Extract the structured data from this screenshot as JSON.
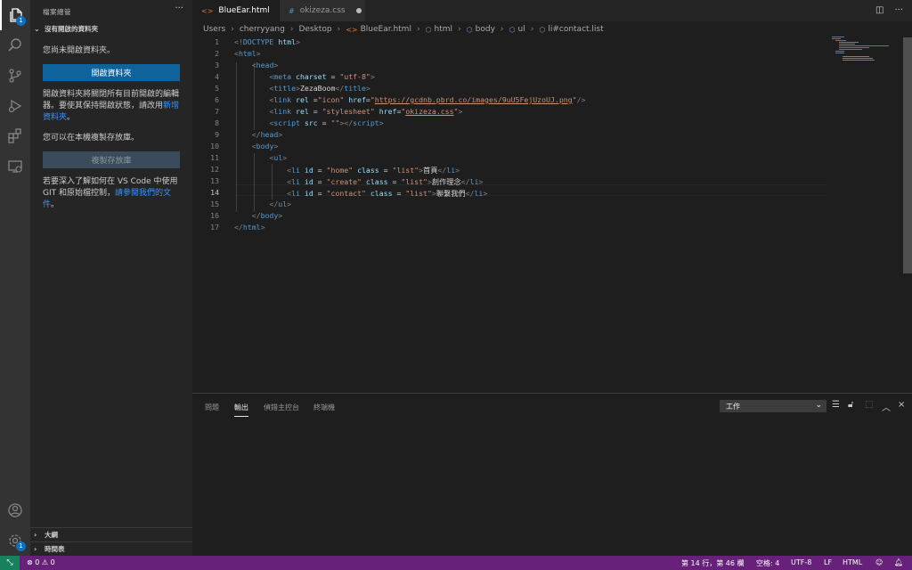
{
  "activity": {
    "explorer_badge": "1",
    "settings_badge": "1"
  },
  "sidebar": {
    "title": "檔案總管",
    "more": "···",
    "section_no_folder": "沒有開啟的資料夾",
    "msg_not_opened": "您尚未開啟資料夾。",
    "open_folder_btn": "開啟資料夾",
    "msg_close_1": "開啟資料夾將關閉所有目前開啟的編輯器。要使其保持開啟狀態，請改用",
    "msg_close_link": "新增資料夾",
    "msg_close_2": "。",
    "msg_clone": "您可以在本機複製存放庫。",
    "clone_btn": "複製存放庫",
    "msg_learn_1": "若要深入了解如何在 VS Code 中使用 GIT 和原始檔控制，",
    "msg_learn_link": "請參閱我們的文件",
    "msg_learn_2": "。",
    "section_outline": "大綱",
    "section_timeline": "時間表"
  },
  "tabs": [
    {
      "label": "BlueEar.html",
      "icon": "html-file-icon"
    },
    {
      "label": "okizeza.css",
      "icon": "css-file-icon"
    }
  ],
  "tab_icons": {
    "html": "<>",
    "css": "#"
  },
  "breadcrumb": [
    "Users",
    "cherryyang",
    "Desktop",
    "BlueEar.html",
    "html",
    "body",
    "ul",
    "li#contact.list"
  ],
  "editor": {
    "line_numbers": [
      "1",
      "2",
      "3",
      "4",
      "5",
      "6",
      "7",
      "8",
      "9",
      "10",
      "11",
      "12",
      "13",
      "14",
      "15",
      "16",
      "17"
    ],
    "current_line": "14"
  },
  "panel": {
    "tabs": [
      "問題",
      "輸出",
      "偵錯主控台",
      "終端機"
    ],
    "active_tab": "輸出",
    "output_channel": "工作"
  },
  "status": {
    "errors": "0",
    "warnings": "0",
    "position": "第 14 行，第 46 欄",
    "spaces": "空格: 4",
    "encoding": "UTF-8",
    "eol": "LF",
    "language": "HTML"
  },
  "colors": {
    "accent": "#0e639c",
    "status_bar": "#68217a",
    "remote": "#16825d"
  }
}
